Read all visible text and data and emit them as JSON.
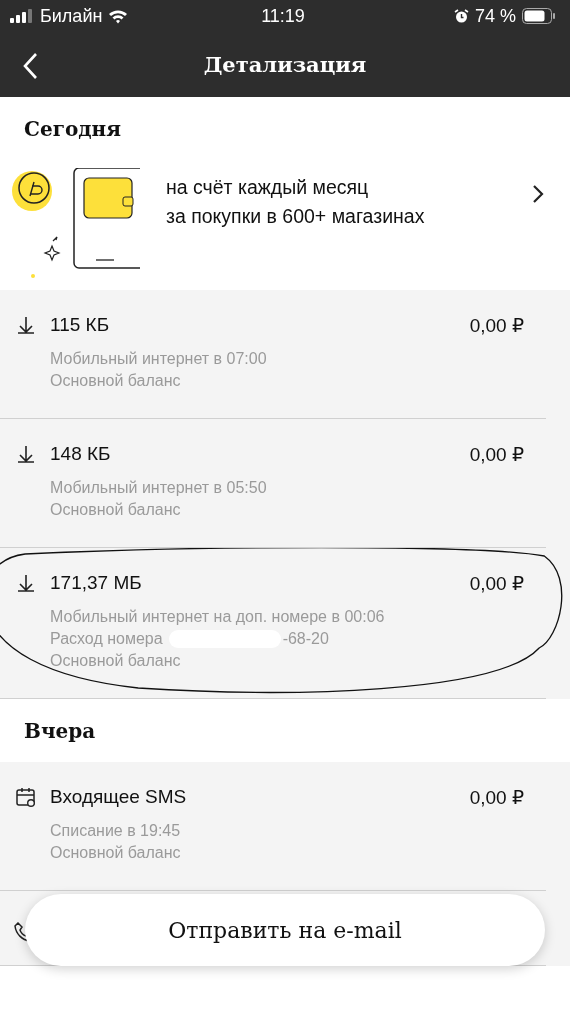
{
  "status_bar": {
    "carrier": "Билайн",
    "time": "11:19",
    "battery": "74 %"
  },
  "header": {
    "title": "Детализация"
  },
  "sections": [
    {
      "title": "Сегодня",
      "banner": {
        "lines": [
          "на счёт каждый месяц",
          "за покупки в 600+ магазинах"
        ]
      },
      "items": [
        {
          "kind": "download",
          "title": "115 КБ",
          "amount": "0,00 ₽",
          "details": [
            "Мобильный интернет в 07:00",
            "Основной баланс"
          ],
          "highlighted": false
        },
        {
          "kind": "download",
          "title": "148 КБ",
          "amount": "0,00 ₽",
          "details": [
            "Мобильный интернет в 05:50",
            "Основной баланс"
          ],
          "highlighted": false
        },
        {
          "kind": "download",
          "title": "171,37 МБ",
          "amount": "0,00 ₽",
          "details": [
            "Мобильный интернет на доп. номере в 00:06",
            [
              "Расход номера",
              "-68-20"
            ],
            "Основной баланс"
          ],
          "highlighted": true
        }
      ]
    },
    {
      "title": "Вчера",
      "items": [
        {
          "kind": "sms",
          "title": "Входящее SMS",
          "amount": "0,00 ₽",
          "details": [
            "Списание в 19:45",
            "Основной баланс"
          ],
          "highlighted": false
        },
        {
          "kind": "call",
          "highlighted": false
        }
      ]
    }
  ],
  "action_button": "Отправить на e-mail"
}
